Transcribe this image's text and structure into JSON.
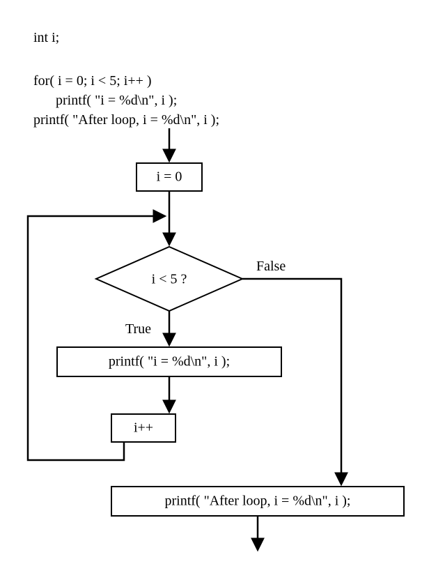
{
  "code": {
    "line1": "int i;",
    "line2": "for( i = 0; i < 5; i++ )",
    "line3": "printf( \"i = %d\\n\", i );",
    "line4": "printf( \"After loop, i = %d\\n\", i );"
  },
  "flow": {
    "init": "i = 0",
    "cond": "i < 5 ?",
    "cond_false": "False",
    "cond_true": "True",
    "body": "printf( \"i = %d\\n\", i );",
    "incr": "i++",
    "after": "printf( \"After loop, i = %d\\n\", i );"
  },
  "chart_data": {
    "type": "flowchart",
    "nodes": [
      {
        "id": "init",
        "kind": "process",
        "label": "i = 0"
      },
      {
        "id": "cond",
        "kind": "decision",
        "label": "i < 5 ?"
      },
      {
        "id": "body",
        "kind": "process",
        "label": "printf( \"i = %d\\n\", i );"
      },
      {
        "id": "incr",
        "kind": "process",
        "label": "i++"
      },
      {
        "id": "after",
        "kind": "process",
        "label": "printf( \"After loop, i = %d\\n\", i );"
      }
    ],
    "edges": [
      {
        "from": "start",
        "to": "init",
        "label": ""
      },
      {
        "from": "init",
        "to": "cond",
        "label": ""
      },
      {
        "from": "cond",
        "to": "body",
        "label": "True"
      },
      {
        "from": "body",
        "to": "incr",
        "label": ""
      },
      {
        "from": "incr",
        "to": "cond",
        "label": ""
      },
      {
        "from": "cond",
        "to": "after",
        "label": "False"
      },
      {
        "from": "after",
        "to": "end",
        "label": ""
      }
    ]
  }
}
